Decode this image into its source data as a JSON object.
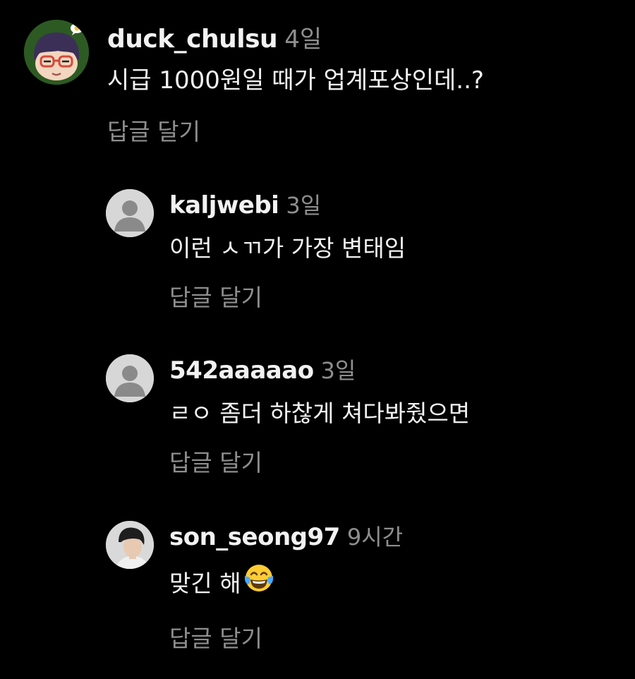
{
  "comments": [
    {
      "username": "duck_chulsu",
      "time": "4일",
      "text": "시급 1000원일 때가 업계포상인데..?",
      "reply_label": "답글 달기",
      "avatar": "cartoon-glasses-face"
    },
    {
      "username": "kaljwebi",
      "time": "3일",
      "text": "이런 ㅅㄲ가 가장 변태임",
      "reply_label": "답글 달기",
      "avatar": "default-user-icon"
    },
    {
      "username": "542aaaaao",
      "time": "3일",
      "text": "ㄹㅇ 좀더 하찮게 쳐다봐줬으면",
      "reply_label": "답글 달기",
      "avatar": "default-user-icon"
    },
    {
      "username": "son_seong97",
      "time": "9시간",
      "text": "맞긴 해",
      "emoji": "face-with-tears-of-joy",
      "reply_label": "답글 달기",
      "avatar": "profile-photo"
    }
  ],
  "colors": {
    "background": "#000000",
    "text": "#f2f2f2",
    "muted": "#8e8e8e",
    "avatar_green": "#2d5a23",
    "avatar_gray": "#d7d7d7"
  }
}
